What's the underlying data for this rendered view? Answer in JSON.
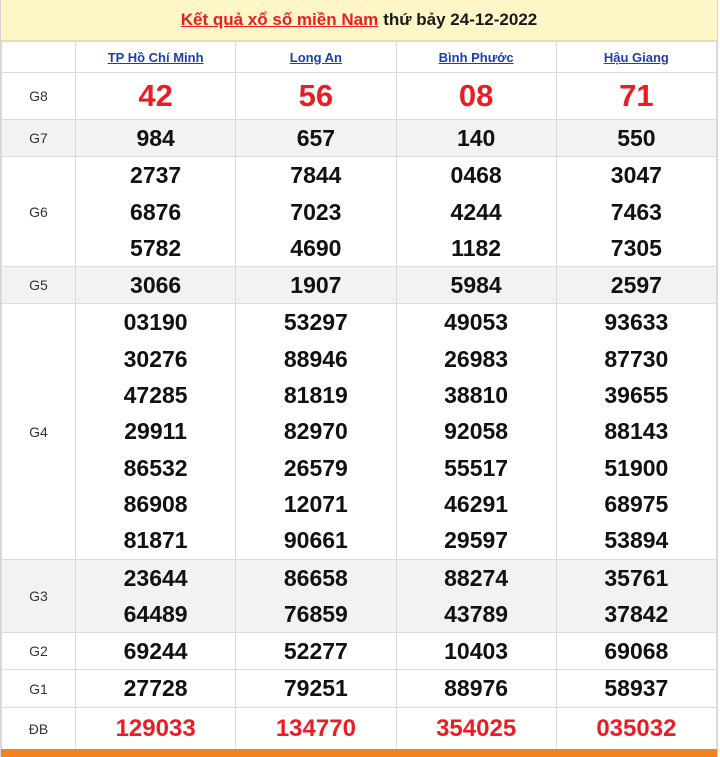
{
  "header": {
    "title_link": "Kết quả xổ số miền Nam",
    "title_rest": "thứ bảy 24-12-2022"
  },
  "provinces": [
    "TP Hồ Chí Minh",
    "Long An",
    "Bình Phước",
    "Hậu Giang"
  ],
  "prizes": [
    {
      "label": "G8",
      "style": "g8",
      "gray": false,
      "values": [
        [
          "42"
        ],
        [
          "56"
        ],
        [
          "08"
        ],
        [
          "71"
        ]
      ]
    },
    {
      "label": "G7",
      "style": "",
      "gray": true,
      "values": [
        [
          "984"
        ],
        [
          "657"
        ],
        [
          "140"
        ],
        [
          "550"
        ]
      ]
    },
    {
      "label": "G6",
      "style": "",
      "gray": false,
      "values": [
        [
          "2737",
          "6876",
          "5782"
        ],
        [
          "7844",
          "7023",
          "4690"
        ],
        [
          "0468",
          "4244",
          "1182"
        ],
        [
          "3047",
          "7463",
          "7305"
        ]
      ]
    },
    {
      "label": "G5",
      "style": "",
      "gray": true,
      "values": [
        [
          "3066"
        ],
        [
          "1907"
        ],
        [
          "5984"
        ],
        [
          "2597"
        ]
      ]
    },
    {
      "label": "G4",
      "style": "",
      "gray": false,
      "values": [
        [
          "03190",
          "30276",
          "47285",
          "29911",
          "86532",
          "86908",
          "81871"
        ],
        [
          "53297",
          "88946",
          "81819",
          "82970",
          "26579",
          "12071",
          "90661"
        ],
        [
          "49053",
          "26983",
          "38810",
          "92058",
          "55517",
          "46291",
          "29597"
        ],
        [
          "93633",
          "87730",
          "39655",
          "88143",
          "51900",
          "68975",
          "53894"
        ]
      ]
    },
    {
      "label": "G3",
      "style": "",
      "gray": true,
      "values": [
        [
          "23644",
          "64489"
        ],
        [
          "86658",
          "76859"
        ],
        [
          "88274",
          "43789"
        ],
        [
          "35761",
          "37842"
        ]
      ]
    },
    {
      "label": "G2",
      "style": "",
      "gray": false,
      "values": [
        [
          "69244"
        ],
        [
          "52277"
        ],
        [
          "10403"
        ],
        [
          "69068"
        ]
      ]
    },
    {
      "label": "G1",
      "style": "",
      "gray": false,
      "values": [
        [
          "27728"
        ],
        [
          "79251"
        ],
        [
          "88976"
        ],
        [
          "58937"
        ]
      ]
    },
    {
      "label": "ĐB",
      "style": "db",
      "gray": false,
      "values": [
        [
          "129033"
        ],
        [
          "134770"
        ],
        [
          "354025"
        ],
        [
          "035032"
        ]
      ]
    }
  ],
  "colors": {
    "accent_red": "#ec1c24",
    "title_bg": "#fff6c8",
    "link_blue": "#1a3fb0",
    "bottom_bar": "#f58220"
  }
}
